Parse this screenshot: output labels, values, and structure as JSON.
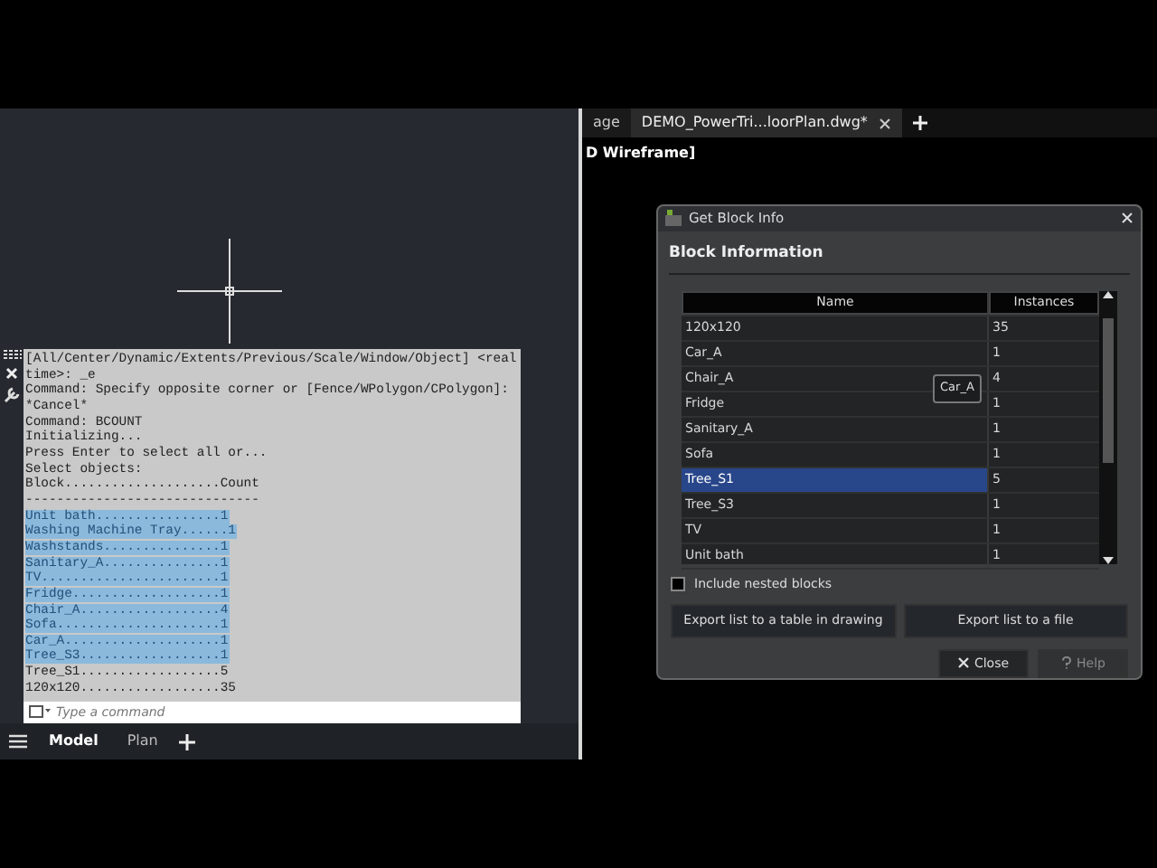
{
  "console": {
    "lines": [
      {
        "text": "[All/Center/Dynamic/Extents/Previous/Scale/Window/Object] <real",
        "selected": false
      },
      {
        "text": "time>: _e",
        "selected": false
      },
      {
        "text": "Command: Specify opposite corner or [Fence/WPolygon/CPolygon]:",
        "selected": false
      },
      {
        "text": "*Cancel*",
        "selected": false
      },
      {
        "text": "Command: BCOUNT",
        "selected": false
      },
      {
        "text": "Initializing...",
        "selected": false
      },
      {
        "text": "Press Enter to select all or...",
        "selected": false
      },
      {
        "text": "Select objects:",
        "selected": false
      },
      {
        "text": "Block....................Count",
        "selected": false
      },
      {
        "text": "------------------------------",
        "selected": false
      },
      {
        "text": "Unit bath................1",
        "selected": true
      },
      {
        "text": "Washing Machine Tray......1",
        "selected": true
      },
      {
        "text": "Washstands...............1",
        "selected": true
      },
      {
        "text": "Sanitary_A...............1",
        "selected": true
      },
      {
        "text": "TV.......................1",
        "selected": true
      },
      {
        "text": "Fridge...................1",
        "selected": true
      },
      {
        "text": "Chair_A..................4",
        "selected": true
      },
      {
        "text": "Sofa.....................1",
        "selected": true
      },
      {
        "text": "Car_A....................1",
        "selected": true
      },
      {
        "text": "Tree_S3..................1",
        "selected": true
      },
      {
        "text": "Tree_S1..................5",
        "selected": false
      },
      {
        "text": "120x120..................35",
        "selected": false
      }
    ],
    "input": {
      "placeholder": "Type a command"
    }
  },
  "layout_tabs": [
    {
      "label": "Model",
      "selected": true
    },
    {
      "label": "Plan",
      "selected": false
    }
  ],
  "doc_tabs": [
    {
      "label": "age",
      "selected": false
    },
    {
      "label": "DEMO_PowerTri...loorPlan.dwg*",
      "selected": true
    }
  ],
  "viewport_label": "D Wireframe]",
  "dialog": {
    "title": "Get Block Info",
    "heading": "Block Information",
    "columns": [
      "Name",
      "Instances"
    ],
    "rows": [
      {
        "name": "120x120",
        "instances": "35",
        "selected": false
      },
      {
        "name": "Car_A",
        "instances": "1",
        "selected": false
      },
      {
        "name": "Chair_A",
        "instances": "4",
        "selected": false
      },
      {
        "name": "Fridge",
        "instances": "1",
        "selected": false
      },
      {
        "name": "Sanitary_A",
        "instances": "1",
        "selected": false
      },
      {
        "name": "Sofa",
        "instances": "1",
        "selected": false
      },
      {
        "name": "Tree_S1",
        "instances": "5",
        "selected": true
      },
      {
        "name": "Tree_S3",
        "instances": "1",
        "selected": false
      },
      {
        "name": "TV",
        "instances": "1",
        "selected": false
      },
      {
        "name": "Unit bath",
        "instances": "1",
        "selected": false
      }
    ],
    "tooltip": "Car_A",
    "nested": {
      "label": "Include nested blocks",
      "checked": false
    },
    "export_buttons": [
      "Export list to a table in drawing",
      "Export list to a file"
    ],
    "buttons": [
      {
        "label": "Close",
        "disabled": false
      },
      {
        "label": "Help",
        "disabled": true
      }
    ]
  }
}
